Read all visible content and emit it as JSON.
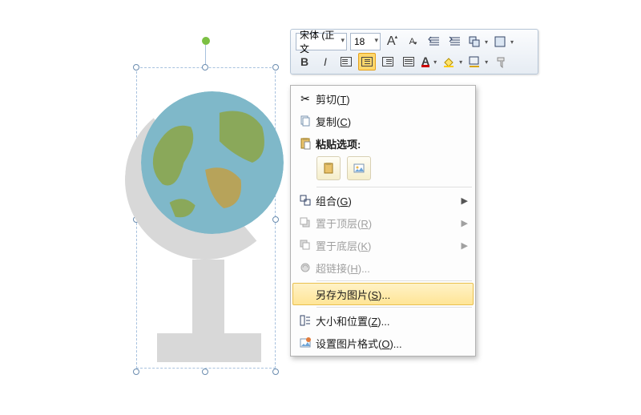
{
  "toolbar": {
    "font_name": "宋体 (正文",
    "font_size": "18",
    "grow_font": "A",
    "shrink_font": "A",
    "bold": "B",
    "italic": "I"
  },
  "menu": {
    "cut": "剪切(T)",
    "copy": "复制(C)",
    "paste_options": "粘贴选项:",
    "group": "组合(G)",
    "bring_front": "置于顶层(R)",
    "send_back": "置于底层(K)",
    "hyperlink": "超链接(H)...",
    "save_as_picture": "另存为图片(S)...",
    "size_position": "大小和位置(Z)...",
    "format_picture": "设置图片格式(O)..."
  },
  "icons": {
    "scissors": "✂",
    "copy": "⿻",
    "clipboard": "📋",
    "paste_pic": "🖼",
    "group": "⿶",
    "front": "▭",
    "back": "▭",
    "link": "🔗",
    "size": "⇲",
    "format": "◧",
    "font_color": "A",
    "highlight": "✎",
    "eraser": "◒"
  }
}
